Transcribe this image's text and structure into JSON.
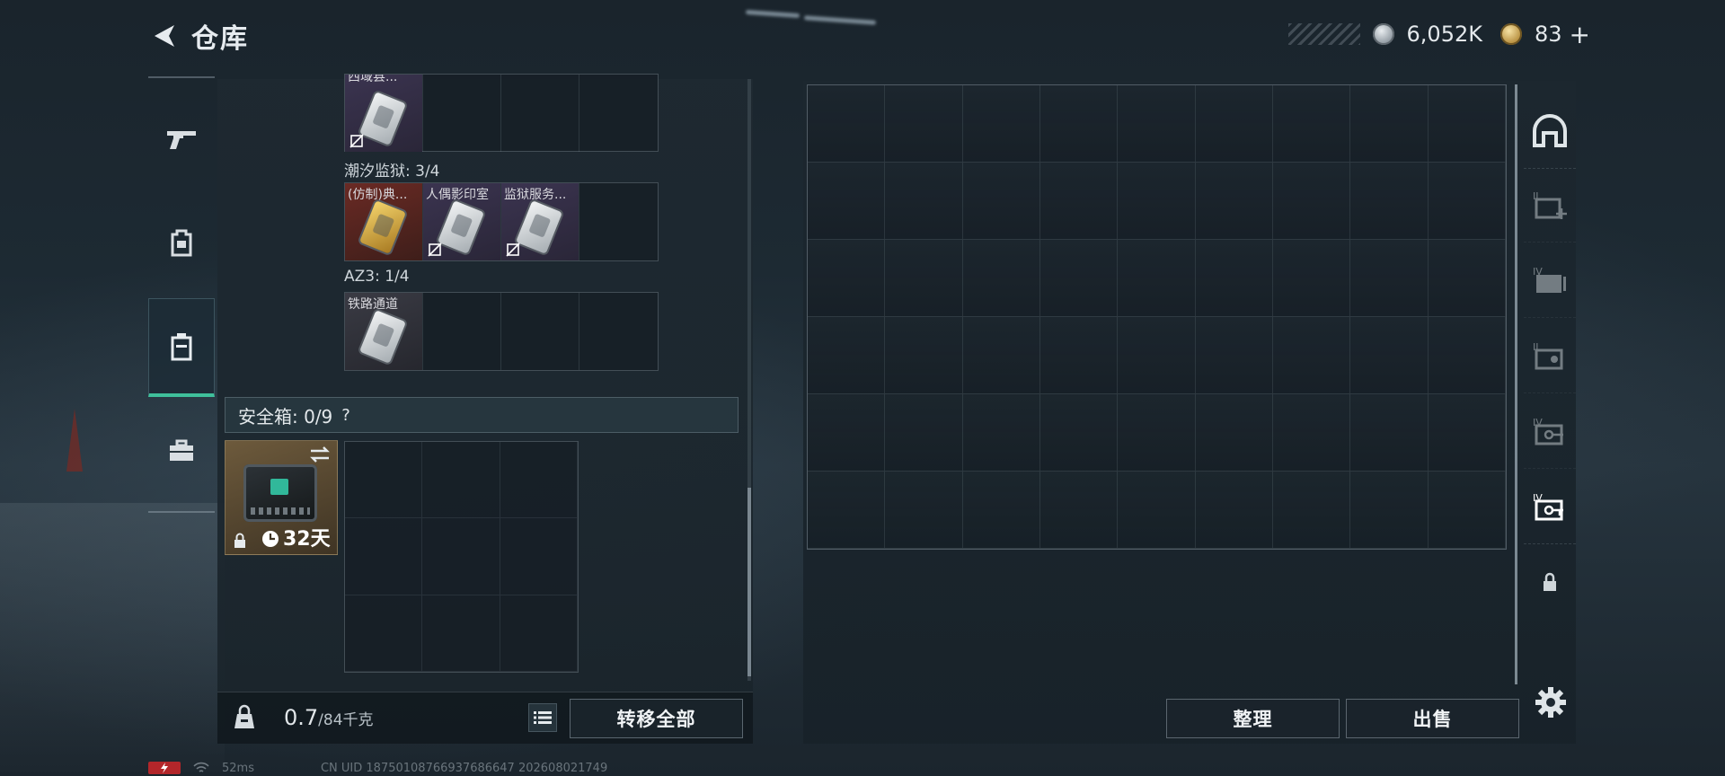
{
  "header": {
    "title": "仓库",
    "silver_amount": "6,052K",
    "gold_amount": "83",
    "gold_plus": "+"
  },
  "left_nav": {
    "items": [
      {
        "icon": "gun-icon",
        "active": false
      },
      {
        "icon": "backpack-icon",
        "active": false
      },
      {
        "icon": "container-icon",
        "active": true
      },
      {
        "icon": "briefcase-icon",
        "active": false
      }
    ]
  },
  "containers": {
    "partial_item_name": "西域县...",
    "groups": [
      {
        "label": "潮汐监狱: 3/4",
        "items": [
          "(仿制)典...",
          "人偶影印室",
          "监狱服务..."
        ]
      },
      {
        "label": "AZ3: 1/4",
        "items": [
          "铁路通道"
        ]
      }
    ]
  },
  "safe_box": {
    "label": "安全箱: 0/9",
    "help": "?",
    "days": "32天"
  },
  "bottom_left": {
    "weight_current": "0.7",
    "weight_max": "/84千克",
    "transfer_all": "转移全部"
  },
  "bottom_right": {
    "sort": "整理",
    "sell": "出售"
  },
  "side_tabs": [
    {
      "icon": "tab-helmet-icon",
      "label": ""
    },
    {
      "icon": "tab-add-card-icon",
      "label": "II"
    },
    {
      "icon": "tab-folder-icon",
      "label": "IV"
    },
    {
      "icon": "tab-card-icon",
      "label": "II"
    },
    {
      "icon": "tab-key-icon",
      "label": "IV"
    },
    {
      "icon": "tab-keycard-icon",
      "label": "IV"
    },
    {
      "icon": "tab-lock-icon",
      "label": ""
    }
  ],
  "status": {
    "ping": "52ms",
    "uid": "CN UID 18750108766937686647 202608021749"
  },
  "colors": {
    "accent": "#3fc09b",
    "panel": "#1e2931"
  }
}
